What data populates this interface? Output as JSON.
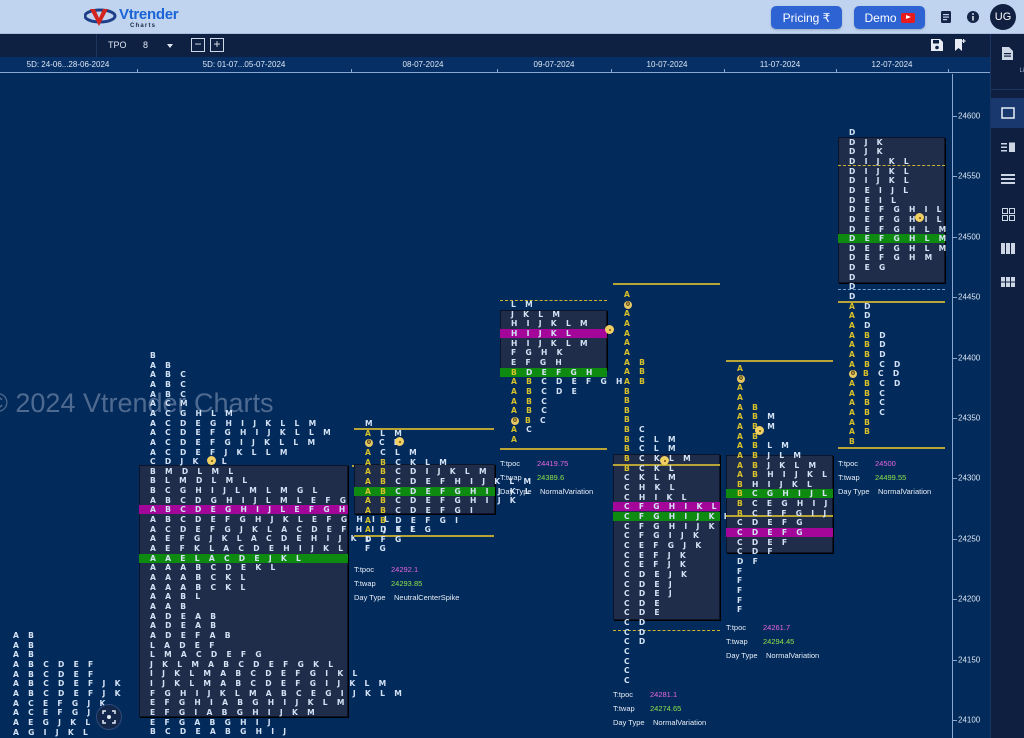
{
  "header": {
    "logo_word": "Vtrender",
    "logo_sub": "Charts",
    "pricing_label": "Pricing ₹",
    "demo_label": "Demo",
    "avatar_initials": "UG",
    "colors": {
      "brand_blue": "#2e63d4",
      "header_bg": "#c0d4f0"
    }
  },
  "toolbar": {
    "chart_type": "TPO",
    "tpo_size": "8",
    "zoom_out": "−",
    "zoom_in": "+"
  },
  "sidebar": {
    "live_label": "Live",
    "layouts": [
      "single-layout",
      "split-layout",
      "rows-layout",
      "grid-2x2-layout",
      "columns-3-layout",
      "grid-3x2-layout"
    ]
  },
  "watermark": "© 2024 Vtrender Charts",
  "date_axis": [
    "5D: 24-06...28-06-2024",
    "5D: 01-07...05-07-2024",
    "08-07-2024",
    "09-07-2024",
    "10-07-2024",
    "11-07-2024",
    "12-07-2024"
  ],
  "price_axis": [
    "24600",
    "24550",
    "24500",
    "24450",
    "24400",
    "24350",
    "24300",
    "24250",
    "24200",
    "24150",
    "24100"
  ],
  "stats_labels": {
    "tpoc": "T:tpoc",
    "twap": "T:twap",
    "daytype": "Day Type"
  },
  "profiles": [
    {
      "date": "5D: 24-06...28-06-2024",
      "rows": [
        "A B",
        "A B",
        "A B",
        "A B C D E F",
        "A B C D E F",
        "A B C D E F J K",
        "A B C D E F J K",
        "A C E F G J K",
        "A C E F G J K L",
        "A E G J K L",
        "A G I J K L"
      ]
    },
    {
      "date": "5D: 01-07...05-07-2024",
      "rows": [
        "B",
        "A B",
        "A B C",
        "A B C",
        "A B C",
        "A C M",
        "A C G H L M",
        "A C D E G H I J K L L M",
        "A C D E F G H I J K L L M",
        "A C D E F G I J K L L M",
        "A C D E F J K L L M",
        "C D J K L L",
        "B M D L M L",
        "B L M D L M L",
        "B C G H I J L M L M G L",
        "A B C D G H I J L M L E F G H L",
        "A B C D E G H I J L E F G H L",
        "A B C D E F G H J K L E F G H I L",
        "A C D E F G J K L A C D E F H I J K L",
        "A E F G J K L A C D E H I J K L",
        "A E F K L A C D E H I J K L",
        "A A E L A C D E J K L",
        "A A A B C D E K L",
        "A A A B C K L",
        "A A A B C K L",
        "A A B L",
        "A A B",
        "A D E A B",
        "A D E A B",
        "A D E F A B",
        "L A D E F",
        "L M A C D E F G",
        "J K L M A B C D E F G K L",
        "I J K L M A B C D E F G I K L",
        "I J K L M A B C D E F G I J K L M",
        "F G H I J K L M A B C E G I J K L M",
        "E F G H I A B G H I J K L M",
        "E F G I A B G H I J K M",
        "E F G A B G H I J",
        "B C D E A B G H I J"
      ]
    },
    {
      "date": "08-07-2024",
      "rows": [
        "M",
        "A L M",
        "0 C L",
        "A C L M",
        "A B C K L M",
        "A B C D I J K L M",
        "A B C D E F H I J K L M",
        "A B C D E F G H I J K L",
        "A B C D E F G H I J K",
        "A B C D E F G I",
        "A B D E F G I",
        "A D E F G",
        "D F G",
        "F G"
      ],
      "tpoc": "24292.1",
      "twap": "24293.85",
      "day_type": "NeutralCenterSpike"
    },
    {
      "date": "09-07-2024",
      "rows": [
        "L M",
        "J K L M",
        "H I J K L M",
        "H I J K L",
        "H I J K L M",
        "F G H K",
        "E F G H",
        "B D E F G H",
        "A B C D E F G H",
        "A B C D E",
        "A B C",
        "A B C",
        "0 B C",
        "A C",
        "A"
      ],
      "tpoc": "24419.75",
      "twap": "24389.6",
      "day_type": "NormalVariation"
    },
    {
      "date": "10-07-2024",
      "rows": [
        "A",
        "0",
        "A",
        "A",
        "A",
        "A",
        "A",
        "A B",
        "A B",
        "A B",
        "B",
        "B",
        "B",
        "B",
        "B C",
        "B C L M",
        "B C L M",
        "B C K L M",
        "B C K L",
        "C K L M",
        "C H K L",
        "C H I K L",
        "C F G H I K L",
        "C F G H I J K L",
        "C F G H I J K",
        "C F G I J K",
        "C E F G J K",
        "C E F J K",
        "C E F J K",
        "C D E J K",
        "C D E J",
        "C D E J",
        "C D E",
        "C D E",
        "C D",
        "C D",
        "C D",
        "C",
        "C",
        "C",
        "C"
      ],
      "tpoc": "24281.1",
      "twap": "24274.65",
      "day_type": "NormalVariation"
    },
    {
      "date": "11-07-2024",
      "rows": [
        "A",
        "0",
        "A",
        "A",
        "A B",
        "A B M",
        "A B M",
        "A B",
        "A B L M",
        "A B J L M",
        "A B J K L M",
        "A B H I J K L",
        "B H I J K L",
        "B C G H I J L",
        "B C E G H I J",
        "B C E F G I J",
        "C D E F G",
        "C D E F G",
        "C D E F",
        "C D F",
        "D F",
        "F",
        "F",
        "F",
        "F",
        "F"
      ],
      "tpoc": "24261.7",
      "twap": "24294.45",
      "day_type": "NormalVariation"
    },
    {
      "date": "12-07-2024",
      "rows": [
        "D",
        "D J K",
        "D J K",
        "D I J K L",
        "D I J K L",
        "D I J K L",
        "D E I J L",
        "D E I L",
        "D E F G H I L",
        "D E F G H I L",
        "D E F G H L M",
        "D E F G H L M",
        "D E F G H L M",
        "D E F G H M",
        "D E G",
        "D",
        "D",
        "D",
        "A D",
        "A D",
        "A D",
        "A B D",
        "A B D",
        "A B D",
        "A B C D",
        "0 B C D",
        "A B C D",
        "A B C",
        "A B C",
        "A B C",
        "A B",
        "A B",
        "B"
      ],
      "tpoc": "24500",
      "twap": "24499.55",
      "day_type": "NormalVariation"
    }
  ]
}
